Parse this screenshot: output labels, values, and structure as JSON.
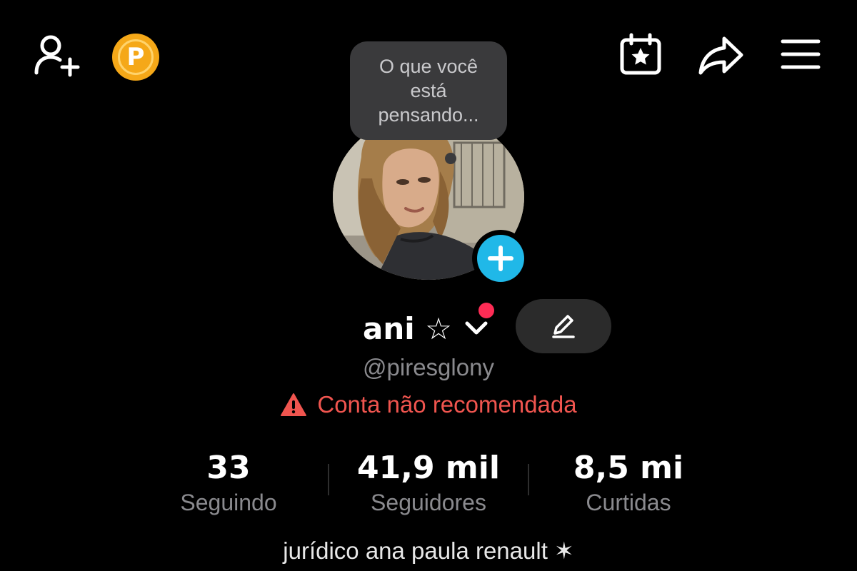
{
  "top_bar": {
    "add_friend_icon": "person-plus-icon",
    "coin_icon": "p-coin-icon",
    "coin_letter": "P",
    "calendar_icon": "calendar-star-icon",
    "share_icon": "share-arrow-icon",
    "menu_icon": "hamburger-menu-icon"
  },
  "profile": {
    "thought_bubble": "O que você está pensando...",
    "display_name": "ani ☆",
    "username": "@piresglony",
    "warning_text": "Conta não recomendada",
    "bio": "jurídico ana paula renault ✶"
  },
  "stats": [
    {
      "value": "33",
      "label": "Seguindo"
    },
    {
      "value": "41,9 mil",
      "label": "Seguidores"
    },
    {
      "value": "8,5 mi",
      "label": "Curtidas"
    }
  ],
  "colors": {
    "background": "#000000",
    "coin": "#f5a818",
    "add_story": "#20b8e8",
    "notification_dot": "#fe2c55",
    "warning": "#f0554f",
    "muted_text": "#8a8a8e"
  }
}
